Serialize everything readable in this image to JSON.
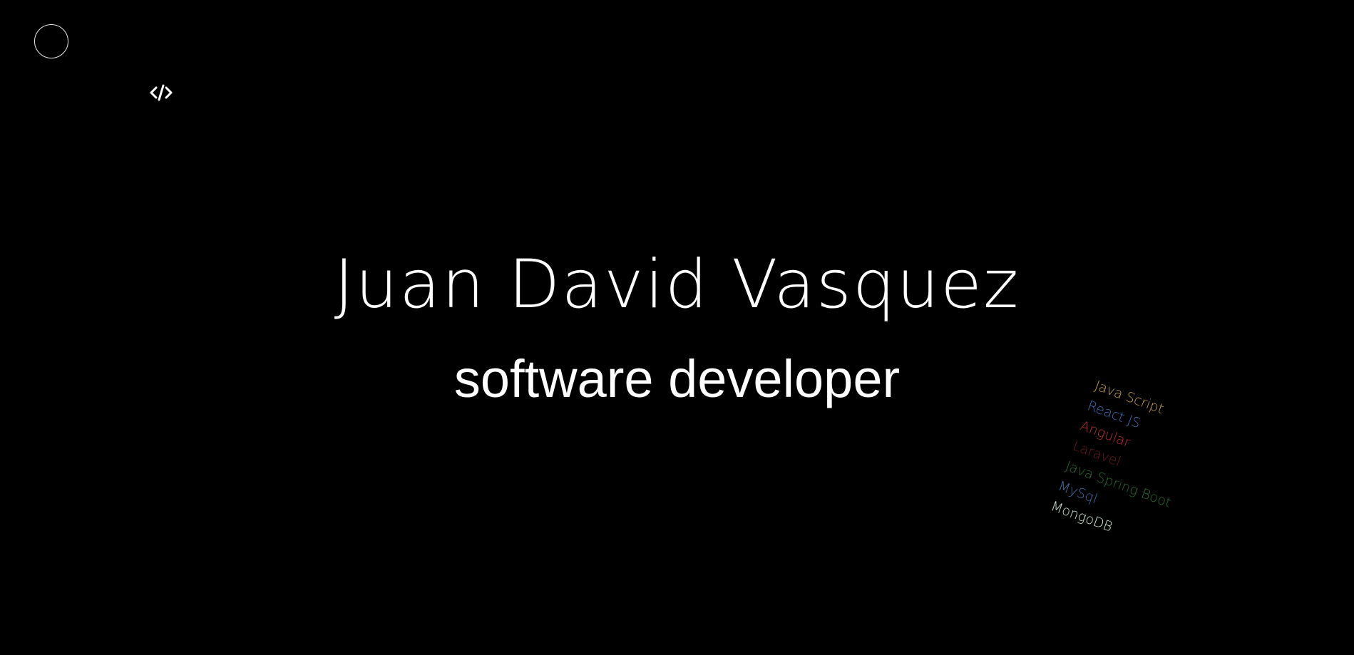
{
  "header": {
    "menu_icon": "circle-menu-icon",
    "logo_icon": "code-brackets-icon"
  },
  "hero": {
    "name": "Juan David Vasquez",
    "role": "software developer"
  },
  "skills": [
    {
      "label": "Java Script",
      "color": "#c9a24a"
    },
    {
      "label": "React JS",
      "color": "#3f6fb5"
    },
    {
      "label": "Angular",
      "color": "#b8302b"
    },
    {
      "label": "Laravel",
      "color": "#6b1d1a"
    },
    {
      "label": "Java Spring Boot",
      "color": "#2e6b35"
    },
    {
      "label": "MySql",
      "color": "#4a6fa5"
    },
    {
      "label": "MongoDB",
      "color": "#cfe3d2"
    }
  ]
}
